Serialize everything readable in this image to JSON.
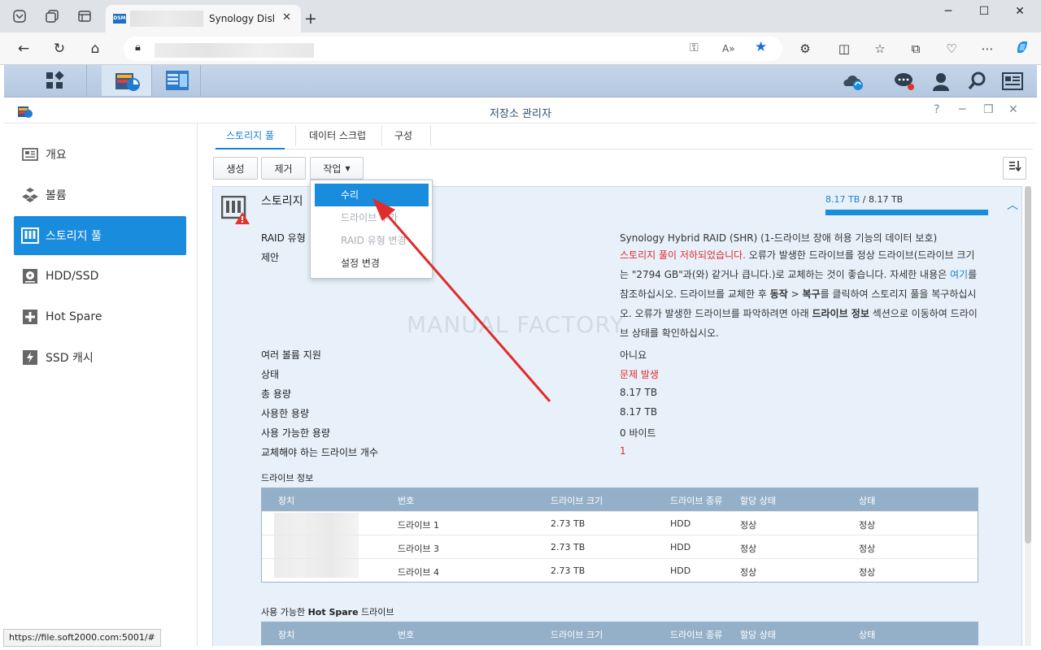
{
  "browser": {
    "tab_title": "Synology DiskS",
    "tab_favicon": "DSM",
    "status_url": "https://file.soft2000.com:5001/#"
  },
  "app": {
    "title": "저장소 관리자",
    "sidebar": [
      {
        "label": "개요",
        "icon": "overview-icon"
      },
      {
        "label": "볼륨",
        "icon": "volume-icon"
      },
      {
        "label": "스토리지 풀",
        "icon": "storage-pool-icon"
      },
      {
        "label": "HDD/SSD",
        "icon": "hdd-icon"
      },
      {
        "label": "Hot Spare",
        "icon": "hot-spare-icon"
      },
      {
        "label": "SSD 캐시",
        "icon": "ssd-cache-icon"
      }
    ],
    "tabs": [
      "스토리지 풀",
      "데이터 스크럽",
      "구성"
    ],
    "toolbar": {
      "create": "생성",
      "remove": "제거",
      "action": "작업"
    },
    "menu": {
      "items": [
        {
          "label": "수리",
          "state": "highlighted"
        },
        {
          "label": "드라이브 추가",
          "state": "disabled"
        },
        {
          "label": "RAID 유형 변경",
          "state": "disabled"
        },
        {
          "label": "설정 변경",
          "state": "normal"
        }
      ]
    },
    "pool": {
      "name": "스토리지",
      "capacity_used": "8.17 TB",
      "capacity_sep": " / ",
      "capacity_total": "8.17 TB",
      "capacity_fill": 1.0,
      "raid_label": "RAID 유형",
      "raid_value": "Synology Hybrid RAID (SHR) (1-드라이브 장애 허용 기능의 데이터 보호)",
      "advice_label": "제안",
      "advice_err": "스토리지 풀이 저하되었습니다.",
      "advice_1": " 오류가 발생한 드라이브를 정상 드라이브(드라이브 크기는 \"2794 GB\"과(와) 같거나 큽니다.)로 교체하는 것이 좋습니다. 자세한 내용은 ",
      "advice_link": "여기",
      "advice_2": "를 참조하십시오. 드라이브를 교체한 후 ",
      "advice_b1": "동작",
      "advice_3": " > ",
      "advice_b2": "복구",
      "advice_4": "를 클릭하여 스토리지 풀을 복구하십시오. 오류가 발생한 드라이브를 파악하려면 아래 ",
      "advice_b3": "드라이브 정보",
      "advice_5": " 섹션으로 이동하여 드라이브 상태를 확인하십시오.",
      "fields": [
        {
          "label": "여러 볼륨 지원",
          "value": "아니요"
        },
        {
          "label": "상태",
          "value": "문제 발생"
        },
        {
          "label": "총 용량",
          "value": "8.17 TB"
        },
        {
          "label": "사용한 용량",
          "value": "8.17 TB"
        },
        {
          "label": "사용 가능한 용량",
          "value": "0 바이트"
        },
        {
          "label": "교체해야 하는 드라이브 개수",
          "value": "1"
        }
      ]
    },
    "drive_info": {
      "title": "드라이브 정보",
      "headers": [
        "장치",
        "번호",
        "드라이브 크기",
        "드라이브 종류",
        "할당 상태",
        "상태"
      ],
      "rows": [
        {
          "num": "드라이브 1",
          "size": "2.73 TB",
          "type": "HDD",
          "alloc": "정상",
          "status": "정상"
        },
        {
          "num": "드라이브 3",
          "size": "2.73 TB",
          "type": "HDD",
          "alloc": "정상",
          "status": "정상"
        },
        {
          "num": "드라이브 4",
          "size": "2.73 TB",
          "type": "HDD",
          "alloc": "정상",
          "status": "정상"
        }
      ]
    },
    "hot_spare": {
      "title_pre": "사용 가능한 ",
      "title_bold": "Hot Spare",
      "title_post": " 드라이브",
      "headers": [
        "장치",
        "번호",
        "드라이브 크기",
        "드라이브 종류",
        "할당 상태",
        "상태"
      ]
    },
    "watermark": "MANUAL FACTORY"
  }
}
